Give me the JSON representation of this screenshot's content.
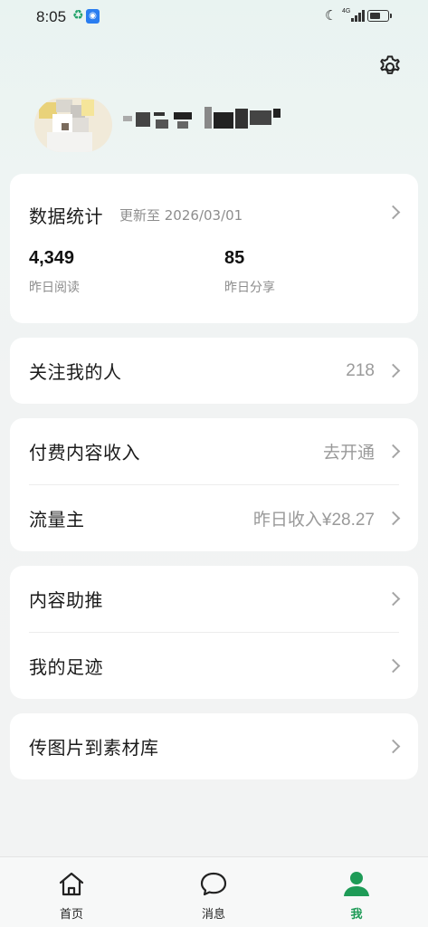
{
  "status_bar": {
    "time": "8:05",
    "network": "4G",
    "icons": [
      "recycle-icon",
      "lightbulb-icon",
      "moon-icon",
      "signal-icon",
      "battery-icon"
    ]
  },
  "header": {
    "settings_icon": "gear-icon"
  },
  "stats_card": {
    "title": "数据统计",
    "updated": "更新至 2026/03/01",
    "items": [
      {
        "value": "4,349",
        "label": "昨日阅读"
      },
      {
        "value": "85",
        "label": "昨日分享"
      }
    ]
  },
  "followers_card": {
    "label": "关注我的人",
    "value": "218"
  },
  "income_card": {
    "rows": [
      {
        "label": "付费内容收入",
        "value": "去开通"
      },
      {
        "label": "流量主",
        "value": "昨日收入¥28.27"
      }
    ]
  },
  "tools_card": {
    "rows": [
      {
        "label": "内容助推"
      },
      {
        "label": "我的足迹"
      }
    ]
  },
  "upload_card": {
    "label": "传图片到素材库"
  },
  "tab_bar": {
    "tabs": [
      {
        "label": "首页",
        "icon": "home-icon",
        "active": false
      },
      {
        "label": "消息",
        "icon": "chat-bubble-icon",
        "active": false
      },
      {
        "label": "我",
        "icon": "person-icon",
        "active": true
      }
    ],
    "active_color": "#1e9b57"
  },
  "colors": {
    "background": "#f2f3f3",
    "card": "#ffffff",
    "muted_text": "#9a9a9a",
    "accent": "#1e9b57"
  }
}
